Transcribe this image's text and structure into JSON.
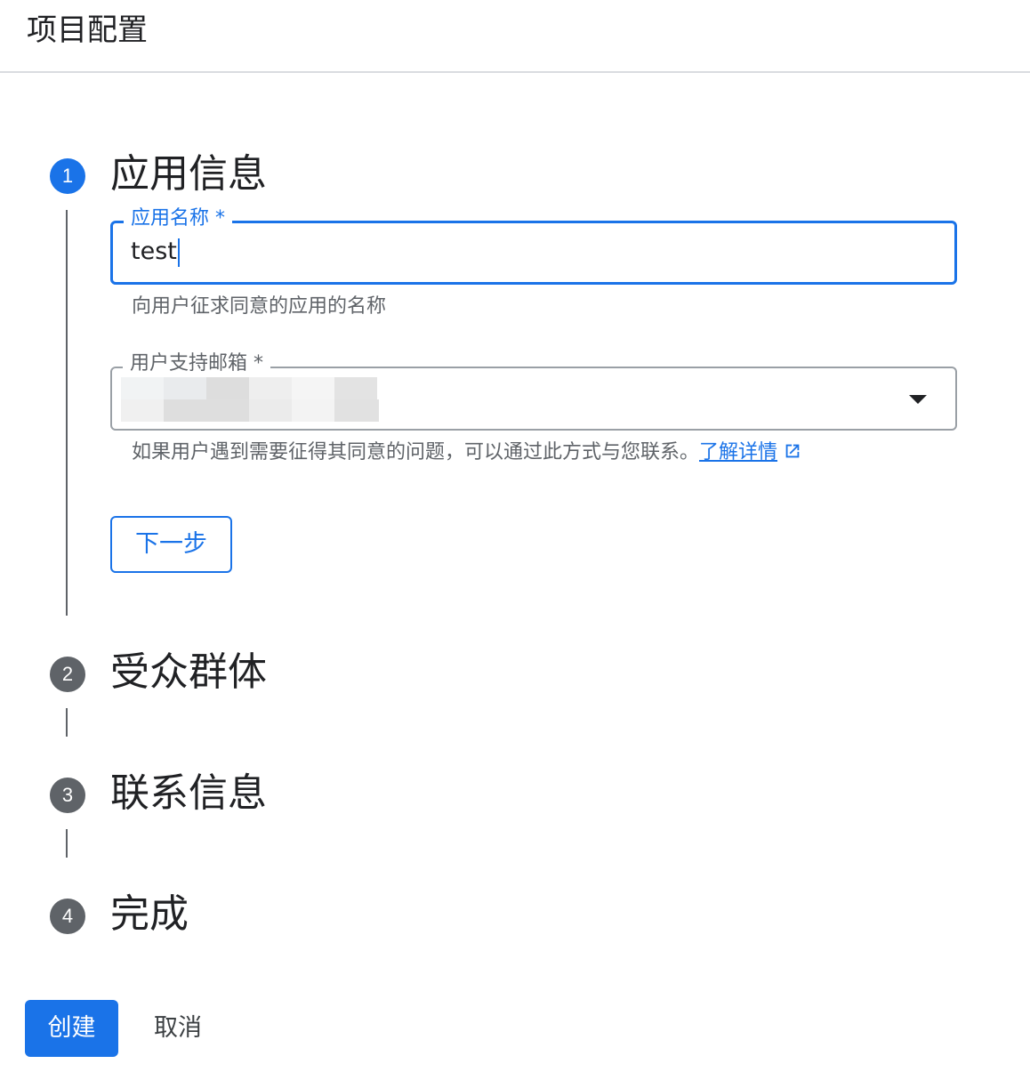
{
  "header": {
    "title": "项目配置"
  },
  "steps": [
    {
      "number": "1",
      "title": "应用信息"
    },
    {
      "number": "2",
      "title": "受众群体"
    },
    {
      "number": "3",
      "title": "联系信息"
    },
    {
      "number": "4",
      "title": "完成"
    }
  ],
  "app_info": {
    "app_name": {
      "label": "应用名称 *",
      "value": "test",
      "helper": "向用户征求同意的应用的名称"
    },
    "support_email": {
      "label": "用户支持邮箱 *",
      "helper": "如果用户遇到需要征得其同意的问题，可以通过此方式与您联系。",
      "learn_more": "了解详情"
    },
    "next_label": "下一步"
  },
  "footer": {
    "create_label": "创建",
    "cancel_label": "取消"
  },
  "colors": {
    "primary": "#1a73e8",
    "inactive_step": "#5f6368",
    "text": "#202124",
    "helper_text": "#5f6368"
  }
}
